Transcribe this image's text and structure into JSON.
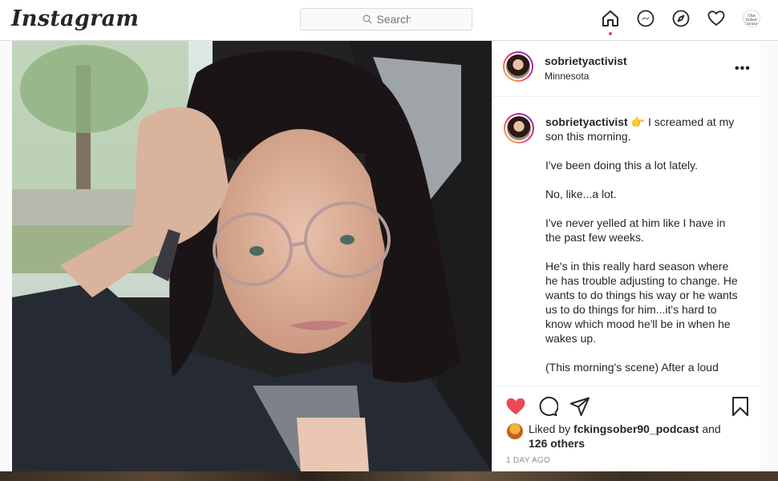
{
  "nav": {
    "logo": "Instagram",
    "search_placeholder": "Search",
    "profile_avatar_text": "The Sober Curator"
  },
  "post": {
    "username": "sobrietyactivist",
    "location": "Minnesota",
    "more_label": "•••",
    "caption": {
      "username": "sobrietyactivist",
      "emoji": "👉",
      "paragraphs": [
        "I screamed at my son this morning.",
        "I've been doing this a lot lately.",
        "No, like...a lot.",
        "I've never yelled at him like I have in the past few weeks.",
        "He's in this really hard season where he has trouble adjusting to change. He wants to do things his way or he wants us to do things for him...it's hard to know which mood he'll be in when he wakes up.",
        "(This morning's scene) After a loud"
      ]
    },
    "liked_by_prefix": "Liked by",
    "liked_by_user": "fckingsober90_podcast",
    "liked_by_and": "and",
    "liked_by_others": "126 others",
    "timestamp": "1 day ago",
    "colors": {
      "like_red": "#ed4956",
      "text": "#262626",
      "muted": "#8e8e8e"
    }
  }
}
